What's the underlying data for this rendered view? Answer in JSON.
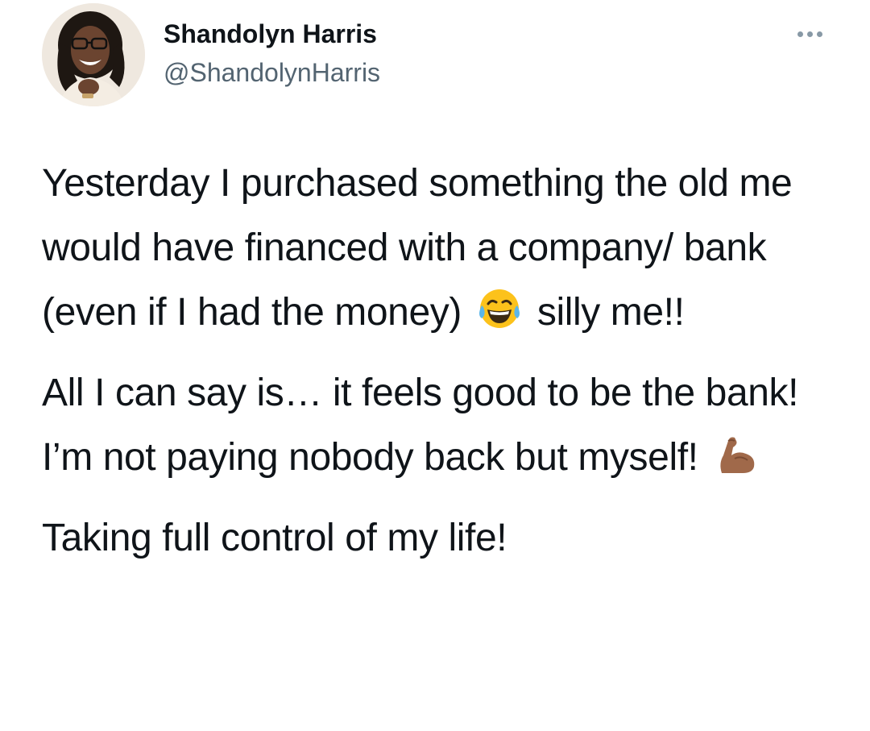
{
  "tweet": {
    "author": {
      "display_name": "Shandolyn Harris",
      "handle": "@ShandolynHarris",
      "avatar_icon": "profile-photo"
    },
    "more_icon": "ellipsis-icon",
    "paragraphs": [
      {
        "before_emoji": "Yesterday I purchased something the old me would have financed with a company/ bank (even if I had the money)",
        "emoji": "face-with-tears-of-joy",
        "after_emoji": "silly me!!"
      },
      {
        "before_emoji": "All I can say is… it feels good to be the bank! I’m not paying nobody back but myself!",
        "emoji": "flexed-biceps-medium-dark-skin",
        "after_emoji": ""
      },
      {
        "before_emoji": "Taking full control of my life!",
        "emoji": "",
        "after_emoji": ""
      }
    ],
    "colors": {
      "text": "#0f1419",
      "secondary_text": "#536471",
      "more_dots": "#8899a6"
    }
  }
}
